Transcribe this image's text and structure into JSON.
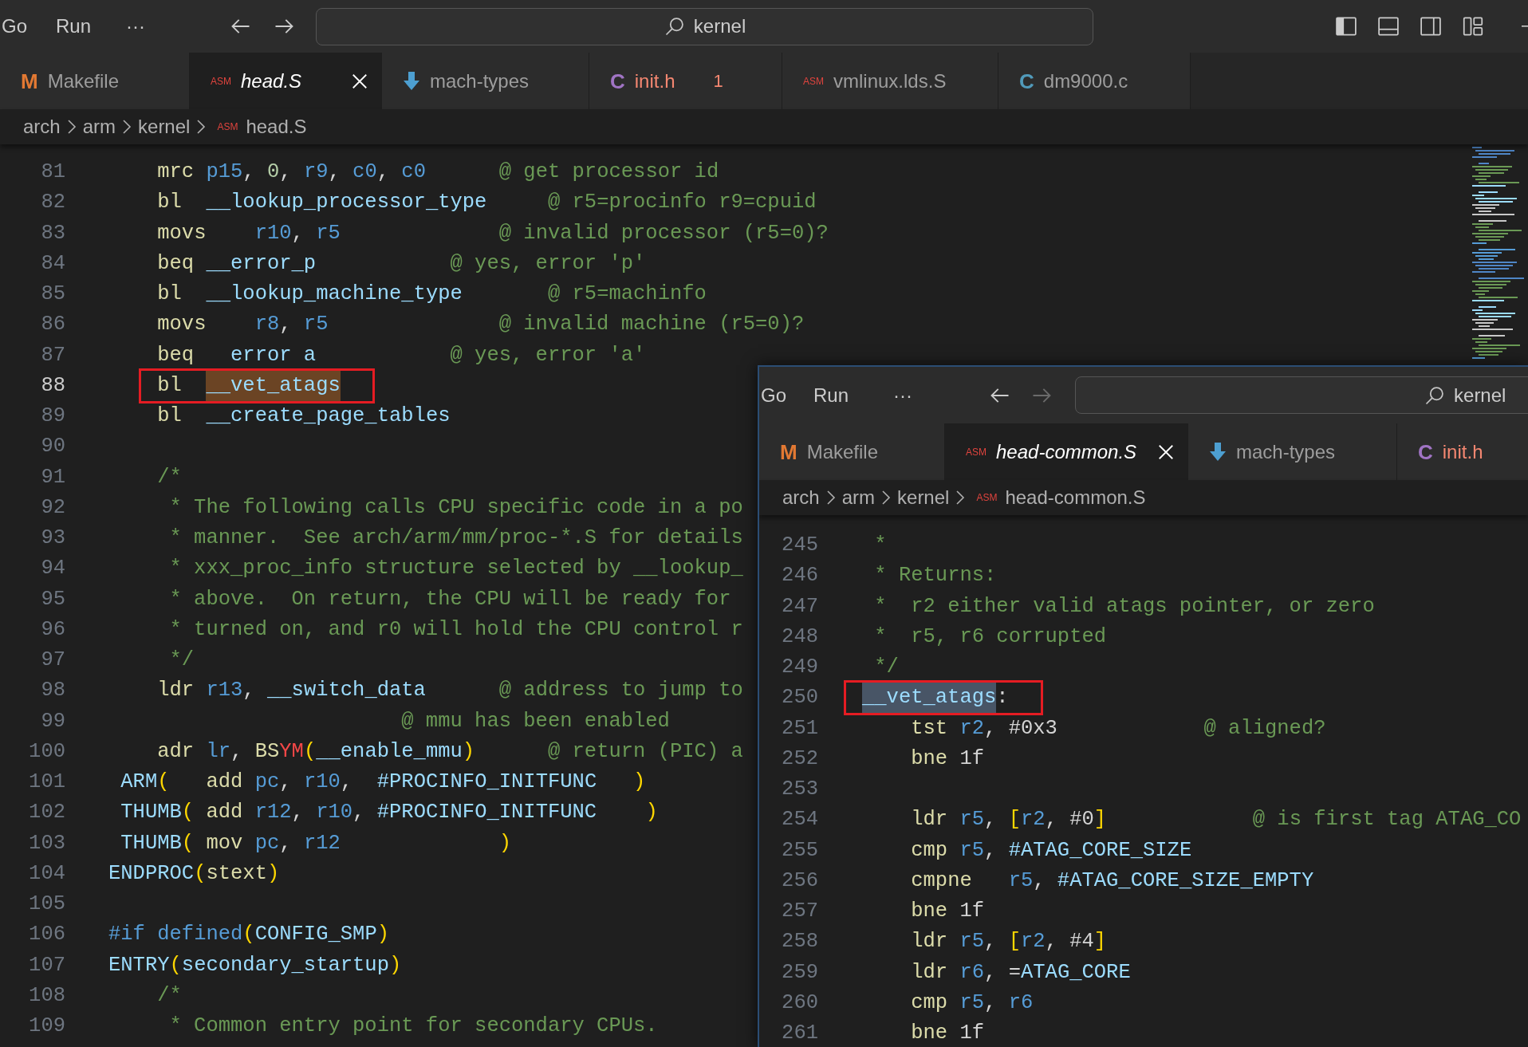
{
  "windows": [
    {
      "titlebar": {
        "menus": [
          "Go",
          "Run"
        ],
        "overflow": "···",
        "search": "kernel",
        "forward_enabled": true
      },
      "tabs": [
        {
          "label": "Makefile",
          "icon": "M",
          "kind": "makefile",
          "selected": false,
          "preview": false,
          "error": false
        },
        {
          "label": "head.S",
          "icon": "ASM",
          "kind": "asm",
          "selected": true,
          "preview": true,
          "error": false
        },
        {
          "label": "mach-types",
          "kind": "download",
          "selected": false,
          "preview": false,
          "error": false
        },
        {
          "label": "init.h",
          "icon": "C",
          "kind": "h",
          "selected": false,
          "preview": false,
          "error": true,
          "problems": "1"
        },
        {
          "label": "vmlinux.lds.S",
          "icon": "ASM",
          "kind": "asm",
          "selected": false,
          "preview": false,
          "error": false
        },
        {
          "label": "dm9000.c",
          "icon": "C",
          "kind": "c",
          "selected": false,
          "preview": false,
          "error": false
        }
      ],
      "breadcrumb": {
        "segments": [
          "arch",
          "arm",
          "kernel"
        ],
        "file_icon": "ASM",
        "file": "head.S"
      },
      "editor": {
        "lines": [
          {
            "number": "81",
            "current": false,
            "boxed": false,
            "tokens": [
              {
                "text": "    mrc ",
                "kind": "op"
              },
              {
                "text": "p15",
                "kind": "reg"
              },
              {
                "text": ", ",
                "kind": "pl"
              },
              {
                "text": "0",
                "kind": "num"
              },
              {
                "text": ", ",
                "kind": "pl"
              },
              {
                "text": "r9",
                "kind": "reg"
              },
              {
                "text": ", ",
                "kind": "pl"
              },
              {
                "text": "c0",
                "kind": "reg"
              },
              {
                "text": ", ",
                "kind": "pl"
              },
              {
                "text": "c0      ",
                "kind": "reg"
              },
              {
                "text": "@ get processor id",
                "kind": "cm"
              }
            ]
          },
          {
            "number": "82",
            "current": false,
            "boxed": false,
            "tokens": [
              {
                "text": "    bl  ",
                "kind": "op"
              },
              {
                "text": "__lookup_processor_type     ",
                "kind": "id"
              },
              {
                "text": "@ r5=procinfo r9=cpuid",
                "kind": "cm"
              }
            ]
          },
          {
            "number": "83",
            "current": false,
            "boxed": false,
            "tokens": [
              {
                "text": "    movs    ",
                "kind": "op"
              },
              {
                "text": "r10",
                "kind": "reg"
              },
              {
                "text": ", ",
                "kind": "pl"
              },
              {
                "text": "r5             ",
                "kind": "reg"
              },
              {
                "text": "@ invalid processor (r5=0)?",
                "kind": "cm"
              }
            ]
          },
          {
            "number": "84",
            "current": false,
            "boxed": false,
            "tokens": [
              {
                "text": "    beq ",
                "kind": "op"
              },
              {
                "text": "__error_p           ",
                "kind": "id"
              },
              {
                "text": "@ yes, error 'p'",
                "kind": "cm"
              }
            ]
          },
          {
            "number": "85",
            "current": false,
            "boxed": false,
            "tokens": [
              {
                "text": "    bl  ",
                "kind": "op"
              },
              {
                "text": "__lookup_machine_type       ",
                "kind": "id"
              },
              {
                "text": "@ r5=machinfo",
                "kind": "cm"
              }
            ]
          },
          {
            "number": "86",
            "current": false,
            "boxed": false,
            "tokens": [
              {
                "text": "    movs    ",
                "kind": "op"
              },
              {
                "text": "r8",
                "kind": "reg"
              },
              {
                "text": ", ",
                "kind": "pl"
              },
              {
                "text": "r5              ",
                "kind": "reg"
              },
              {
                "text": "@ invalid machine (r5=0)?",
                "kind": "cm"
              }
            ]
          },
          {
            "number": "87",
            "current": false,
            "boxed": false,
            "tokens": [
              {
                "text": "    beq   ",
                "kind": "op"
              },
              {
                "text": "error a           ",
                "kind": "id"
              },
              {
                "text": "@ yes, error 'a'",
                "kind": "cm"
              }
            ]
          },
          {
            "number": "88",
            "current": true,
            "boxed": true,
            "tokens": [
              {
                "text": "    bl  ",
                "kind": "op"
              },
              {
                "text": "__vet_atags",
                "kind": "match"
              }
            ]
          },
          {
            "number": "89",
            "current": false,
            "boxed": false,
            "tokens": [
              {
                "text": "    bl  ",
                "kind": "op"
              },
              {
                "text": "__create_page_tables",
                "kind": "id"
              }
            ]
          },
          {
            "number": "90",
            "current": false,
            "boxed": false
          },
          {
            "number": "91",
            "current": false,
            "boxed": false,
            "tokens": [
              {
                "text": "    /*",
                "kind": "cm"
              }
            ]
          },
          {
            "number": "92",
            "current": false,
            "boxed": false,
            "tokens": [
              {
                "text": "     * The following calls CPU specific code in a po",
                "kind": "cm"
              }
            ]
          },
          {
            "number": "93",
            "current": false,
            "boxed": false,
            "tokens": [
              {
                "text": "     * manner.  See arch/arm/mm/proc-*.S for details",
                "kind": "cm"
              }
            ]
          },
          {
            "number": "94",
            "current": false,
            "boxed": false,
            "tokens": [
              {
                "text": "     * xxx_proc_info structure selected by __lookup_",
                "kind": "cm"
              }
            ]
          },
          {
            "number": "95",
            "current": false,
            "boxed": false,
            "tokens": [
              {
                "text": "     * above.  On return, the CPU will be ready for",
                "kind": "cm"
              }
            ]
          },
          {
            "number": "96",
            "current": false,
            "boxed": false,
            "tokens": [
              {
                "text": "     * turned on, and r0 will hold the CPU control r",
                "kind": "cm"
              }
            ]
          },
          {
            "number": "97",
            "current": false,
            "boxed": false,
            "tokens": [
              {
                "text": "     */",
                "kind": "cm"
              }
            ]
          },
          {
            "number": "98",
            "current": false,
            "boxed": false,
            "tokens": [
              {
                "text": "    ldr ",
                "kind": "op"
              },
              {
                "text": "r13",
                "kind": "reg"
              },
              {
                "text": ", ",
                "kind": "pl"
              },
              {
                "text": "__switch_data      ",
                "kind": "id"
              },
              {
                "text": "@ address to jump to",
                "kind": "cm"
              }
            ]
          },
          {
            "number": "99",
            "current": false,
            "boxed": false,
            "tokens": [
              {
                "text": "                        @ mmu has been enabled",
                "kind": "cm"
              }
            ]
          },
          {
            "number": "100",
            "current": false,
            "boxed": false,
            "tokens": [
              {
                "text": "    adr ",
                "kind": "op"
              },
              {
                "text": "lr",
                "kind": "reg"
              },
              {
                "text": ", ",
                "kind": "pl"
              },
              {
                "text": "BS",
                "kind": "op"
              },
              {
                "text": "YM",
                "kind": "err"
              },
              {
                "text": "(",
                "kind": "br"
              },
              {
                "text": "__enable_mmu",
                "kind": "id"
              },
              {
                "text": ")      ",
                "kind": "br"
              },
              {
                "text": "@ return (PIC) a",
                "kind": "cm"
              }
            ]
          },
          {
            "number": "101",
            "current": false,
            "boxed": false,
            "tokens": [
              {
                "text": " ARM",
                "kind": "id"
              },
              {
                "text": "(   ",
                "kind": "br"
              },
              {
                "text": "add ",
                "kind": "op"
              },
              {
                "text": "pc",
                "kind": "reg"
              },
              {
                "text": ", ",
                "kind": "pl"
              },
              {
                "text": "r10",
                "kind": "reg"
              },
              {
                "text": ",  ",
                "kind": "pl"
              },
              {
                "text": "#PROCINFO_INITFUNC   ",
                "kind": "const"
              },
              {
                "text": ")",
                "kind": "br"
              }
            ]
          },
          {
            "number": "102",
            "current": false,
            "boxed": false,
            "tokens": [
              {
                "text": " THUMB",
                "kind": "id"
              },
              {
                "text": "( ",
                "kind": "br"
              },
              {
                "text": "add ",
                "kind": "op"
              },
              {
                "text": "r12",
                "kind": "reg"
              },
              {
                "text": ", ",
                "kind": "pl"
              },
              {
                "text": "r10",
                "kind": "reg"
              },
              {
                "text": ", ",
                "kind": "pl"
              },
              {
                "text": "#PROCINFO_INITFUNC    ",
                "kind": "const"
              },
              {
                "text": ")",
                "kind": "br"
              }
            ]
          },
          {
            "number": "103",
            "current": false,
            "boxed": false,
            "tokens": [
              {
                "text": " THUMB",
                "kind": "id"
              },
              {
                "text": "( ",
                "kind": "br"
              },
              {
                "text": "mov ",
                "kind": "op"
              },
              {
                "text": "pc",
                "kind": "reg"
              },
              {
                "text": ", ",
                "kind": "pl"
              },
              {
                "text": "r12             ",
                "kind": "reg"
              },
              {
                "text": ")",
                "kind": "br"
              }
            ]
          },
          {
            "number": "104",
            "current": false,
            "boxed": false,
            "tokens": [
              {
                "text": "ENDPROC",
                "kind": "id"
              },
              {
                "text": "(",
                "kind": "br"
              },
              {
                "text": "stext",
                "kind": "op"
              },
              {
                "text": ")",
                "kind": "br"
              }
            ]
          },
          {
            "number": "105",
            "current": false,
            "boxed": false
          },
          {
            "number": "106",
            "current": false,
            "boxed": false,
            "tokens": [
              {
                "text": "#if ",
                "kind": "kw"
              },
              {
                "text": "defined",
                "kind": "kw"
              },
              {
                "text": "(",
                "kind": "br"
              },
              {
                "text": "CONFIG_SMP",
                "kind": "id"
              },
              {
                "text": ")",
                "kind": "br"
              }
            ]
          },
          {
            "number": "107",
            "current": false,
            "boxed": false,
            "tokens": [
              {
                "text": "ENTRY",
                "kind": "id"
              },
              {
                "text": "(",
                "kind": "br"
              },
              {
                "text": "secondary_startup",
                "kind": "id"
              },
              {
                "text": ")",
                "kind": "br"
              }
            ]
          },
          {
            "number": "108",
            "current": false,
            "boxed": false,
            "tokens": [
              {
                "text": "    /*",
                "kind": "cm"
              }
            ]
          },
          {
            "number": "109",
            "current": false,
            "boxed": false,
            "tokens": [
              {
                "text": "     * Common entry point for secondary CPUs.",
                "kind": "cm"
              }
            ]
          }
        ]
      }
    },
    {
      "titlebar": {
        "menus": [
          "Go",
          "Run"
        ],
        "overflow": "···",
        "search": "kernel",
        "forward_enabled": false
      },
      "tabs": [
        {
          "label": "Makefile",
          "icon": "M",
          "kind": "makefile",
          "selected": false,
          "preview": false,
          "error": false
        },
        {
          "label": "head-common.S",
          "icon": "ASM",
          "kind": "asm",
          "selected": true,
          "preview": true,
          "error": false
        },
        {
          "label": "mach-types",
          "kind": "download",
          "selected": false,
          "preview": false,
          "error": false
        },
        {
          "label": "init.h",
          "icon": "C",
          "kind": "h",
          "selected": false,
          "preview": false,
          "error": true
        }
      ],
      "breadcrumb": {
        "segments": [
          "arch",
          "arm",
          "kernel"
        ],
        "file_icon": "ASM",
        "file": "head-common.S"
      },
      "editor": {
        "lines": [
          {
            "number": "245",
            "current": false,
            "boxed": false,
            "tokens": [
              {
                "text": " *",
                "kind": "cm"
              }
            ]
          },
          {
            "number": "246",
            "current": false,
            "boxed": false,
            "tokens": [
              {
                "text": " * Returns:",
                "kind": "cm"
              }
            ]
          },
          {
            "number": "247",
            "current": false,
            "boxed": false,
            "tokens": [
              {
                "text": " *  r2 either valid atags pointer, or zero",
                "kind": "cm"
              }
            ]
          },
          {
            "number": "248",
            "current": false,
            "boxed": false,
            "tokens": [
              {
                "text": " *  r5, r6 corrupted",
                "kind": "cm"
              }
            ]
          },
          {
            "number": "249",
            "current": false,
            "boxed": false,
            "tokens": [
              {
                "text": " */",
                "kind": "cm"
              }
            ]
          },
          {
            "number": "250",
            "current": false,
            "boxed": true,
            "tokens": [
              {
                "text": "__vet_atags",
                "kind": "sel"
              },
              {
                "text": ":",
                "kind": "pl"
              }
            ]
          },
          {
            "number": "251",
            "current": false,
            "boxed": false,
            "tokens": [
              {
                "text": "    tst ",
                "kind": "op"
              },
              {
                "text": "r2",
                "kind": "reg"
              },
              {
                "text": ", ",
                "kind": "pl"
              },
              {
                "text": "#0x3            ",
                "kind": "pl"
              },
              {
                "text": "@ aligned?",
                "kind": "cm"
              }
            ]
          },
          {
            "number": "252",
            "current": false,
            "boxed": false,
            "tokens": [
              {
                "text": "    bne ",
                "kind": "op"
              },
              {
                "text": "1f",
                "kind": "pl"
              }
            ]
          },
          {
            "number": "253",
            "current": false,
            "boxed": false
          },
          {
            "number": "254",
            "current": false,
            "boxed": false,
            "tokens": [
              {
                "text": "    ldr ",
                "kind": "op"
              },
              {
                "text": "r5",
                "kind": "reg"
              },
              {
                "text": ", ",
                "kind": "pl"
              },
              {
                "text": "[",
                "kind": "br"
              },
              {
                "text": "r2",
                "kind": "reg"
              },
              {
                "text": ", #0",
                "kind": "pl"
              },
              {
                "text": "]            ",
                "kind": "br"
              },
              {
                "text": "@ is first tag ATAG_CO",
                "kind": "cm"
              }
            ]
          },
          {
            "number": "255",
            "current": false,
            "boxed": false,
            "tokens": [
              {
                "text": "    cmp ",
                "kind": "op"
              },
              {
                "text": "r5",
                "kind": "reg"
              },
              {
                "text": ", ",
                "kind": "pl"
              },
              {
                "text": "#ATAG_CORE_SIZE",
                "kind": "const"
              }
            ]
          },
          {
            "number": "256",
            "current": false,
            "boxed": false,
            "tokens": [
              {
                "text": "    cmpne   ",
                "kind": "op"
              },
              {
                "text": "r5",
                "kind": "reg"
              },
              {
                "text": ", ",
                "kind": "pl"
              },
              {
                "text": "#ATAG_CORE_SIZE_EMPTY",
                "kind": "const"
              }
            ]
          },
          {
            "number": "257",
            "current": false,
            "boxed": false,
            "tokens": [
              {
                "text": "    bne ",
                "kind": "op"
              },
              {
                "text": "1f",
                "kind": "pl"
              }
            ]
          },
          {
            "number": "258",
            "current": false,
            "boxed": false,
            "tokens": [
              {
                "text": "    ldr ",
                "kind": "op"
              },
              {
                "text": "r5",
                "kind": "reg"
              },
              {
                "text": ", ",
                "kind": "pl"
              },
              {
                "text": "[",
                "kind": "br"
              },
              {
                "text": "r2",
                "kind": "reg"
              },
              {
                "text": ", #4",
                "kind": "pl"
              },
              {
                "text": "]",
                "kind": "br"
              }
            ]
          },
          {
            "number": "259",
            "current": false,
            "boxed": false,
            "tokens": [
              {
                "text": "    ldr ",
                "kind": "op"
              },
              {
                "text": "r6",
                "kind": "reg"
              },
              {
                "text": ", =",
                "kind": "pl"
              },
              {
                "text": "ATAG_CORE",
                "kind": "const"
              }
            ]
          },
          {
            "number": "260",
            "current": false,
            "boxed": false,
            "tokens": [
              {
                "text": "    cmp ",
                "kind": "op"
              },
              {
                "text": "r5",
                "kind": "reg"
              },
              {
                "text": ", ",
                "kind": "pl"
              },
              {
                "text": "r6",
                "kind": "reg"
              }
            ]
          },
          {
            "number": "261",
            "current": false,
            "boxed": false,
            "tokens": [
              {
                "text": "    bne ",
                "kind": "op"
              },
              {
                "text": "1f",
                "kind": "pl"
              }
            ]
          }
        ]
      }
    }
  ]
}
